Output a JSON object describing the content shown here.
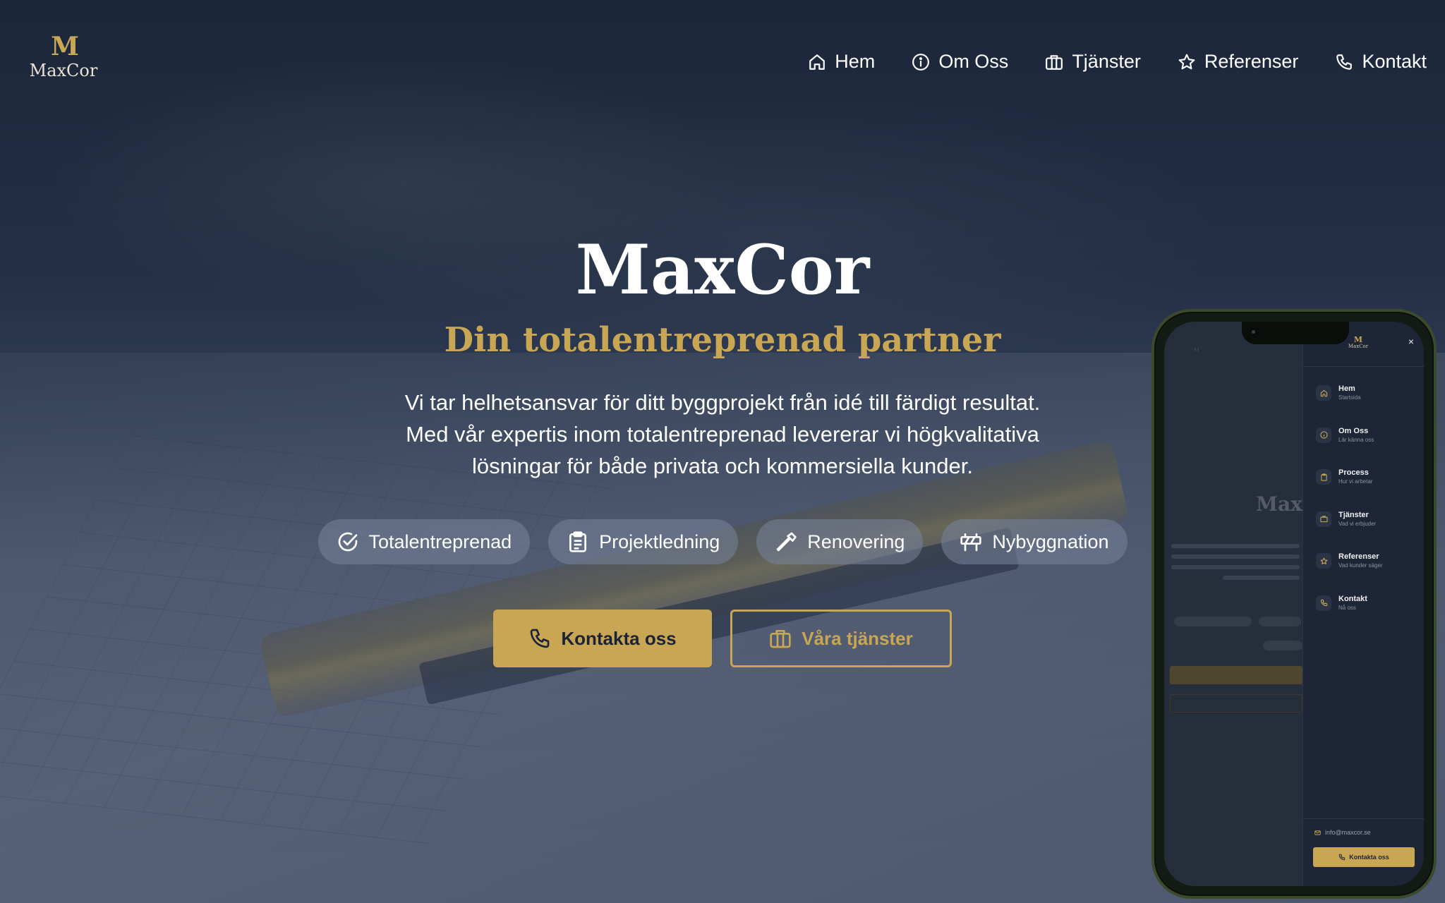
{
  "brand": {
    "logo_mark": "M",
    "name": "MaxCor"
  },
  "nav": {
    "items": [
      {
        "label": "Hem",
        "icon": "home-icon"
      },
      {
        "label": "Om Oss",
        "icon": "info-icon"
      },
      {
        "label": "Tjänster",
        "icon": "briefcase-icon"
      },
      {
        "label": "Referenser",
        "icon": "star-icon"
      },
      {
        "label": "Kontakt",
        "icon": "phone-icon"
      }
    ]
  },
  "hero": {
    "title": "MaxCor",
    "subtitle": "Din totalentreprenad partner",
    "description_lines": [
      "Vi tar helhetsansvar för ditt byggprojekt från idé till färdigt resultat.",
      "Med vår expertis inom totalentreprenad levererar vi högkvalitativa",
      "lösningar för både privata och kommersiella kunder."
    ],
    "chips": [
      {
        "label": "Totalentreprenad",
        "icon": "check-circle-icon"
      },
      {
        "label": "Projektledning",
        "icon": "clipboard-icon"
      },
      {
        "label": "Renovering",
        "icon": "hammer-icon"
      },
      {
        "label": "Nybyggnation",
        "icon": "construction-barrier-icon"
      }
    ],
    "primary_cta": {
      "label": "Kontakta oss",
      "icon": "phone-icon"
    },
    "secondary_cta": {
      "label": "Våra tjänster",
      "icon": "briefcase-icon"
    }
  },
  "mobile_menu": {
    "close_symbol": "×",
    "items": [
      {
        "label": "Hem",
        "sublabel": "Startsida",
        "icon": "home-icon"
      },
      {
        "label": "Om Oss",
        "sublabel": "Lär känna oss",
        "icon": "info-icon"
      },
      {
        "label": "Process",
        "sublabel": "Hur vi arbetar",
        "icon": "clipboard-icon"
      },
      {
        "label": "Tjänster",
        "sublabel": "Vad vi erbjuder",
        "icon": "briefcase-icon"
      },
      {
        "label": "Referenser",
        "sublabel": "Vad kunder säger",
        "icon": "star-icon"
      },
      {
        "label": "Kontakt",
        "sublabel": "Nå oss",
        "icon": "phone-icon"
      }
    ],
    "email": "info@maxcor.se",
    "cta_label": "Kontakta oss",
    "behind_title": "MaxC"
  },
  "colors": {
    "accent": "#c9a653",
    "background": "#1f2a3e",
    "text": "#ffffff"
  }
}
